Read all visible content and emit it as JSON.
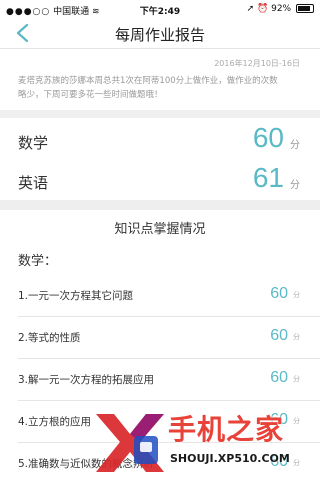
{
  "statusbar": {
    "carrier": "中国联通",
    "time": "下午2:49",
    "battery": "92%"
  },
  "navbar": {
    "title": "每周作业报告"
  },
  "report": {
    "date_range": "2016年12月10日-16日",
    "message": "麦塔克苏族的莎娜本周总共1次在阿蒂100分上做作业，做作业的次数略少，下周可要多花一些时间做题哦！"
  },
  "scores": [
    {
      "subject": "数学",
      "value": "60",
      "unit": "分"
    },
    {
      "subject": "英语",
      "value": "61",
      "unit": "分"
    }
  ],
  "knowledge": {
    "title": "知识点掌握情况",
    "subject": "数学：",
    "items": [
      {
        "label": "1.一元一次方程其它问题",
        "score": "60",
        "unit": "分"
      },
      {
        "label": "2.等式的性质",
        "score": "60",
        "unit": "分"
      },
      {
        "label": "3.解一元一次方程的拓展应用",
        "score": "60",
        "unit": "分"
      },
      {
        "label": "4.立方根的应用",
        "score": "60",
        "unit": "分"
      },
      {
        "label": "5.准确数与近似数的概念辨析",
        "score": "60",
        "unit": "分"
      }
    ]
  },
  "watermark": {
    "text": "手机之家",
    "url": "SHOUJI.XP510.COM"
  },
  "colors": {
    "accent": "#5ab9c6",
    "separator": "#eeeeee"
  }
}
